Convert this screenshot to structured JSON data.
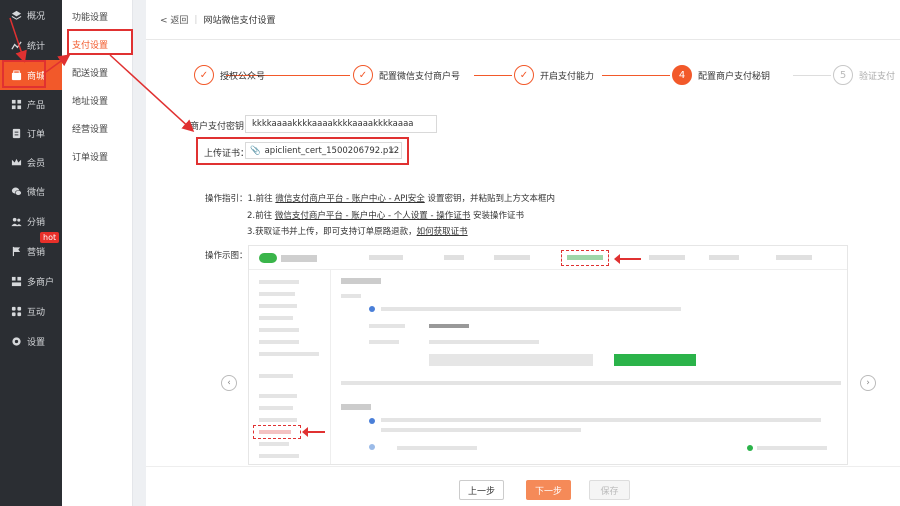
{
  "nav": {
    "items": [
      {
        "label": "概况",
        "icon": "layers-icon"
      },
      {
        "label": "统计",
        "icon": "chart-icon"
      },
      {
        "label": "商城",
        "icon": "shop-icon",
        "active": true
      },
      {
        "label": "产品",
        "icon": "grid-icon"
      },
      {
        "label": "订单",
        "icon": "clipboard-icon"
      },
      {
        "label": "会员",
        "icon": "crown-icon"
      },
      {
        "label": "微信",
        "icon": "wechat-icon"
      },
      {
        "label": "分销",
        "icon": "users-icon"
      },
      {
        "label": "营销",
        "icon": "flag-icon",
        "badge": "hot"
      },
      {
        "label": "多商户",
        "icon": "store-icon"
      },
      {
        "label": "互动",
        "icon": "interact-icon"
      },
      {
        "label": "设置",
        "icon": "gear-icon"
      }
    ]
  },
  "subnav": {
    "items": [
      "功能设置",
      "支付设置",
      "配送设置",
      "地址设置",
      "经营设置",
      "订单设置"
    ],
    "active": "支付设置"
  },
  "header": {
    "back": "< 返回",
    "title": "网站微信支付设置"
  },
  "steps": [
    {
      "num": "✓",
      "label": "授权公众号",
      "state": "done"
    },
    {
      "num": "✓",
      "label": "配置微信支付商户号",
      "state": "done"
    },
    {
      "num": "✓",
      "label": "开启支付能力",
      "state": "done"
    },
    {
      "num": "4",
      "label": "配置商户支付秘钥",
      "state": "current"
    },
    {
      "num": "5",
      "label": "验证支付",
      "state": "todo"
    }
  ],
  "form": {
    "key_label": "商户支付密钥：",
    "key_value": "kkkkaaaakkkkaaaakkkkaaaakkkkaaaa",
    "cert_label": "上传证书：",
    "cert_file": "apiclient_cert_1500206792.p12"
  },
  "guide": {
    "label": "操作指引：",
    "line1_a": "1.前往",
    "line1_link": "微信支付商户平台 - 账户中心 - API安全",
    "line1_b": "设置密钥，并粘贴到上方文本框内",
    "line2_a": "2.前往",
    "line2_link": "微信支付商户平台 - 账户中心 - 个人设置 - 操作证书",
    "line2_b": "安装操作证书",
    "line3_a": "3.获取证书并上传，即可支持订单原路退款，",
    "line3_link": "如何获取证书"
  },
  "demo": {
    "label": "操作示图："
  },
  "footer": {
    "prev": "上一步",
    "next": "下一步",
    "save": "保存"
  },
  "colors": {
    "accent": "#f2592a",
    "highlight": "#e03131",
    "nav_bg": "#2b2e33",
    "wechat_green": "#2bb34a"
  }
}
